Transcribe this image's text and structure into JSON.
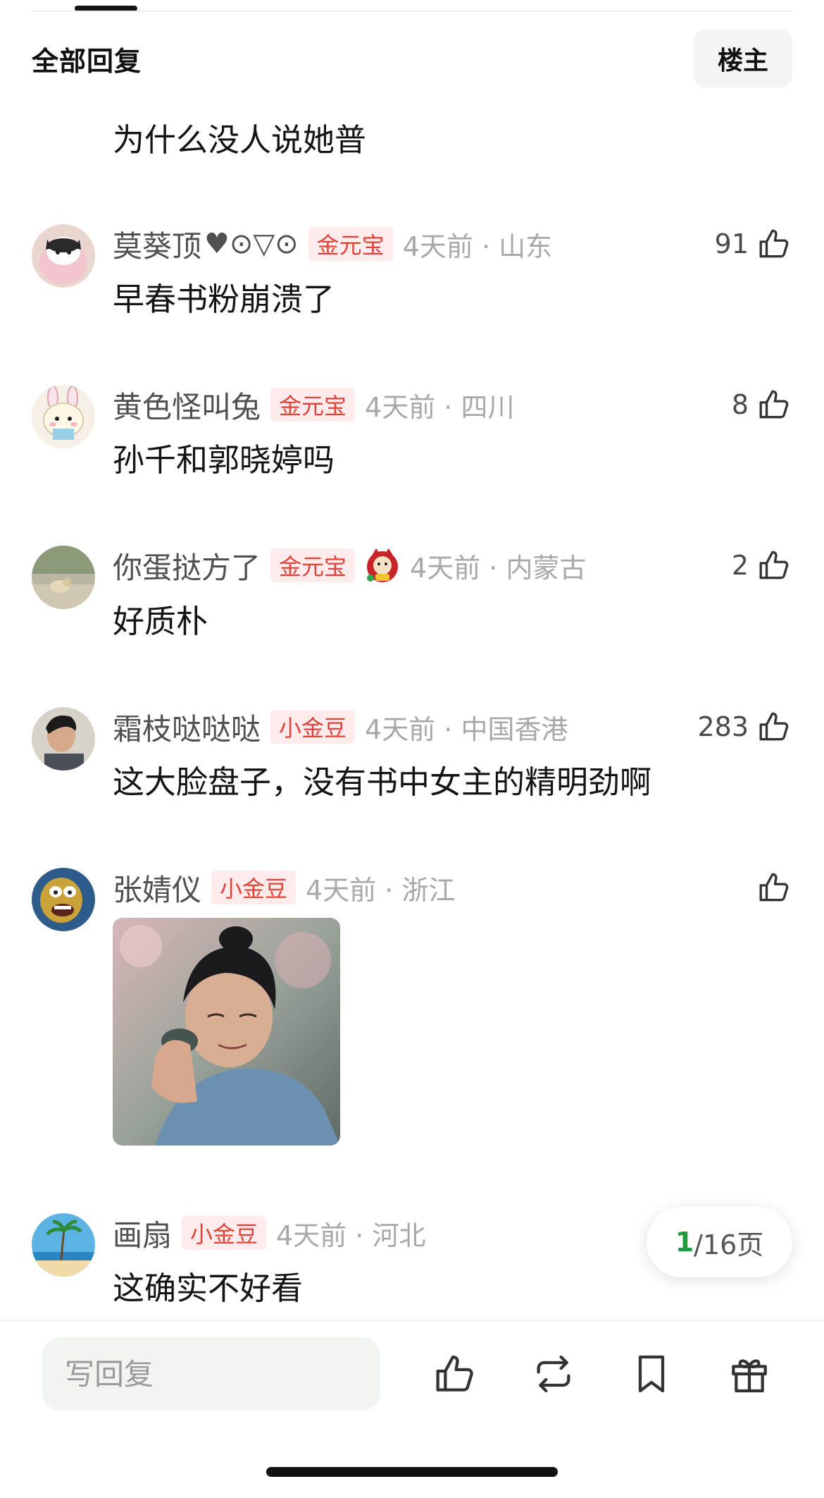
{
  "header": {
    "title": "全部回复",
    "filter_label": "楼主"
  },
  "comments": [
    {
      "text": "为什么没人说她普"
    },
    {
      "user": "莫葵顶",
      "user_suffix": "♥⊙▽⊙",
      "badge": "金元宝",
      "time_loc": "4天前 · 山东",
      "likes": "91",
      "text": "早春书粉崩溃了"
    },
    {
      "user": "黄色怪叫兔",
      "badge": "金元宝",
      "time_loc": "4天前 · 四川",
      "likes": "8",
      "text": "孙千和郭晓婷吗"
    },
    {
      "user": "你蛋挞方了",
      "badge": "金元宝",
      "time_loc": "4天前 · 内蒙古",
      "likes": "2",
      "text": "好质朴"
    },
    {
      "user": "霜枝哒哒哒",
      "badge": "小金豆",
      "time_loc": "4天前 · 中国香港",
      "likes": "283",
      "text": "这大脸盘子，没有书中女主的精明劲啊"
    },
    {
      "user": "张婧仪",
      "badge": "小金豆",
      "time_loc": "4天前 · 浙江",
      "likes": ""
    },
    {
      "user": "画扇",
      "badge": "小金豆",
      "time_loc": "4天前 · 河北",
      "likes": "",
      "text": "这确实不好看"
    }
  ],
  "pager": {
    "current": "1",
    "total_text": "/16页"
  },
  "bottom_bar": {
    "reply_placeholder": "写回复"
  },
  "colors": {
    "badge_bg": "#fdeceb",
    "badge_text": "#e0433b",
    "pager_accent": "#1f9d3c",
    "input_bg": "#f1f5f2"
  },
  "icons": {
    "like": "thumbs-up-icon",
    "repost": "repost-icon",
    "bookmark": "bookmark-icon",
    "gift": "gift-icon",
    "medal": "fortune-cat-medal-icon"
  }
}
